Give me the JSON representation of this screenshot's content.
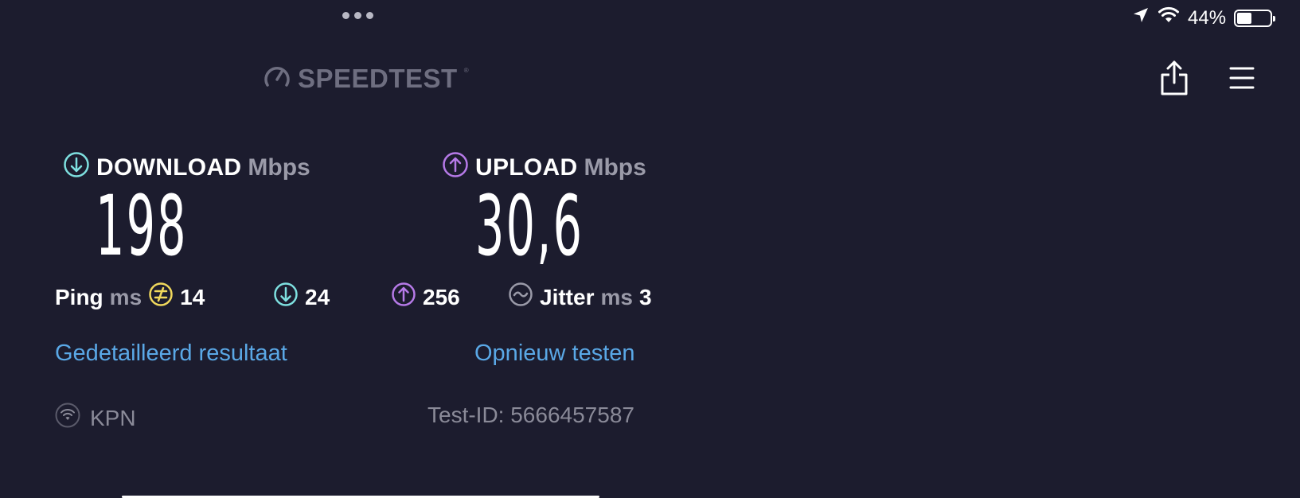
{
  "status_bar": {
    "battery_level": "44%",
    "battery_fraction": 0.44
  },
  "header": {
    "brand": "SPEEDTEST",
    "trademark": "®"
  },
  "download": {
    "label": "DOWNLOAD",
    "unit": "Mbps",
    "value": "198"
  },
  "upload": {
    "label": "UPLOAD",
    "unit": "Mbps",
    "value": "30,6"
  },
  "latency": {
    "ping_label": "Ping",
    "ping_unit": "ms",
    "idle_value": "14",
    "download_value": "24",
    "upload_value": "256",
    "jitter_label": "Jitter",
    "jitter_unit": "ms",
    "jitter_value": "3"
  },
  "links": {
    "detailed": "Gedetailleerd resultaat",
    "retest": "Opnieuw testen"
  },
  "footer": {
    "provider": "KPN",
    "test_id": "Test-ID: 5666457587"
  },
  "colors": {
    "background": "#1c1c2e",
    "download_accent": "#7ee0e0",
    "upload_accent": "#b67ae8",
    "ping_accent": "#f0d85c",
    "link": "#5aa8e6"
  }
}
